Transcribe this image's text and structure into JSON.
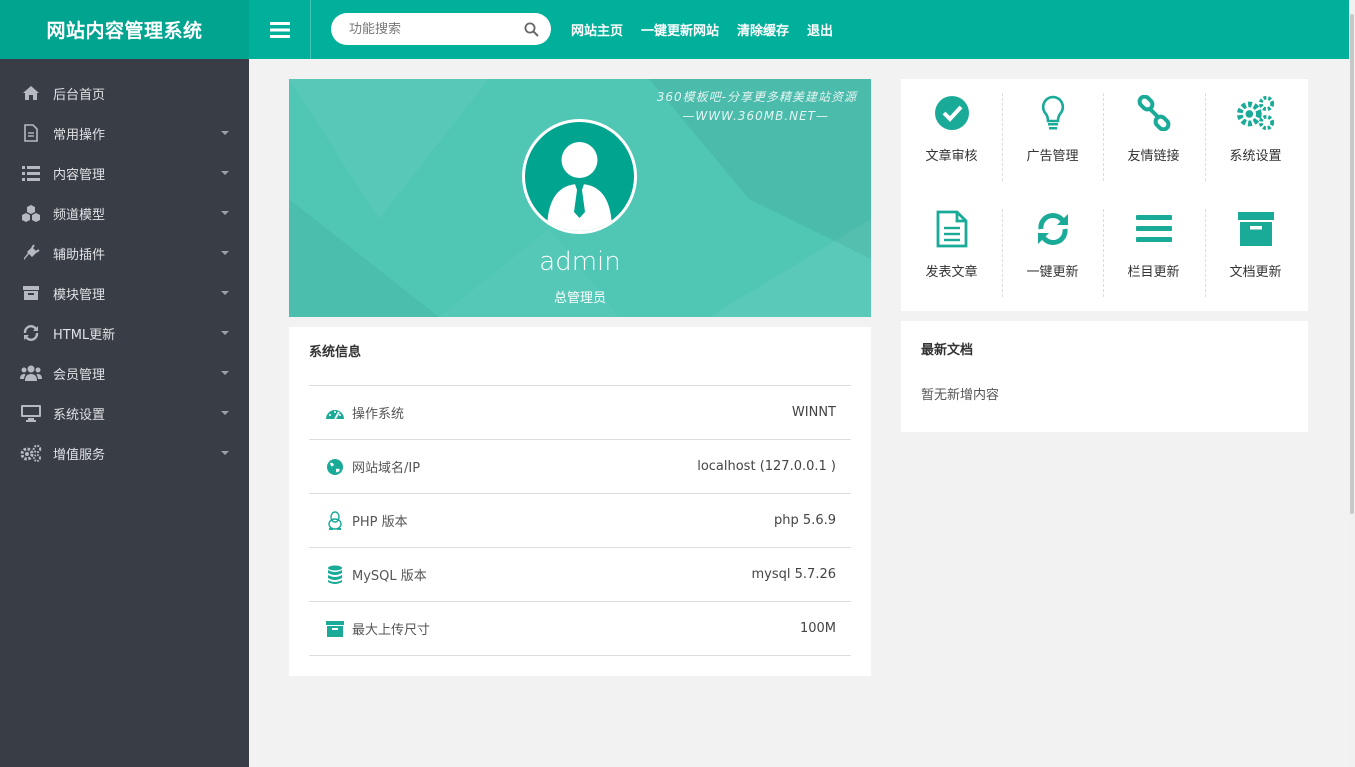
{
  "header": {
    "logo": "网站内容管理系统",
    "search_placeholder": "功能搜索",
    "nav": [
      "网站主页",
      "一键更新网站",
      "清除缓存",
      "退出"
    ]
  },
  "sidebar": {
    "items": [
      {
        "label": "后台首页",
        "icon": "home-icon",
        "caret": false
      },
      {
        "label": "常用操作",
        "icon": "file-icon",
        "caret": true
      },
      {
        "label": "内容管理",
        "icon": "list-icon",
        "caret": true
      },
      {
        "label": "频道模型",
        "icon": "cubes-icon",
        "caret": true
      },
      {
        "label": "辅助插件",
        "icon": "plug-icon",
        "caret": true
      },
      {
        "label": "模块管理",
        "icon": "archive-icon",
        "caret": true
      },
      {
        "label": "HTML更新",
        "icon": "refresh-icon",
        "caret": true
      },
      {
        "label": "会员管理",
        "icon": "users-icon",
        "caret": true
      },
      {
        "label": "系统设置",
        "icon": "desktop-icon",
        "caret": true
      },
      {
        "label": "增值服务",
        "icon": "cogs-icon",
        "caret": true
      }
    ]
  },
  "profile": {
    "watermark_line1": "360模板吧-分享更多精美建站资源",
    "watermark_line2": "—WWW.360MB.NET—",
    "name": "admin",
    "role": "总管理员"
  },
  "sysinfo": {
    "title": "系统信息",
    "rows": [
      {
        "icon": "dashboard-icon",
        "label": "操作系统",
        "value": "WINNT"
      },
      {
        "icon": "globe-icon",
        "label": "网站域名/IP",
        "value": "localhost (127.0.0.1 )"
      },
      {
        "icon": "linux-icon",
        "label": "PHP 版本",
        "value": "php 5.6.9"
      },
      {
        "icon": "database-icon",
        "label": "MySQL 版本",
        "value": "mysql 5.7.26"
      },
      {
        "icon": "archive-icon",
        "label": "最大上传尺寸",
        "value": "100M"
      }
    ]
  },
  "quick": {
    "items": [
      {
        "label": "文章审核",
        "icon": "check-circle-icon"
      },
      {
        "label": "广告管理",
        "icon": "lightbulb-icon"
      },
      {
        "label": "友情链接",
        "icon": "link-icon"
      },
      {
        "label": "系统设置",
        "icon": "cogs-icon"
      },
      {
        "label": "发表文章",
        "icon": "file-text-icon"
      },
      {
        "label": "一键更新",
        "icon": "refresh-icon"
      },
      {
        "label": "栏目更新",
        "icon": "bars-icon"
      },
      {
        "label": "文档更新",
        "icon": "archive-icon"
      }
    ]
  },
  "latest": {
    "title": "最新文档",
    "empty_text": "暂无新增内容"
  },
  "colors": {
    "accent": "#00b09a",
    "accent_dark": "#00a48f",
    "sidebar_bg": "#393d46",
    "icon_color": "#1aaa98"
  }
}
